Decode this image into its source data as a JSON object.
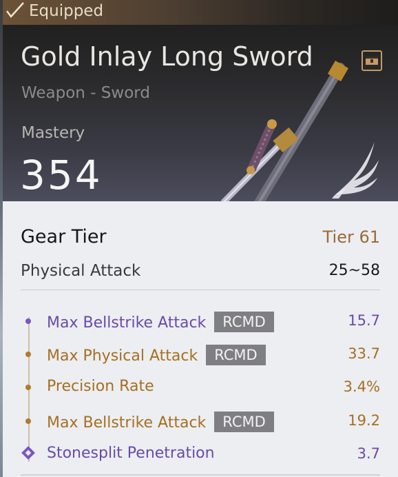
{
  "header": {
    "equipped_label": "Equipped",
    "item_name": "Gold Inlay Long Sword",
    "item_type": "Weapon - Sword",
    "mastery_label": "Mastery",
    "mastery_value": "354",
    "icons": [
      "check-icon",
      "chest-icon",
      "sword-image",
      "wing-icon"
    ]
  },
  "gear_tier": {
    "label": "Gear Tier",
    "value": "Tier 61"
  },
  "physical_attack": {
    "label": "Physical Attack",
    "value": "25~58"
  },
  "stats": [
    {
      "label": "Max Bellstrike Attack",
      "badge": "RCMD",
      "value": "15.7",
      "color": "#6a4aa8",
      "bullet": "purple-dot"
    },
    {
      "label": "Max Physical Attack",
      "badge": "RCMD",
      "value": "33.7",
      "color": "#a76f1f",
      "bullet": "gold-dot"
    },
    {
      "label": "Precision Rate",
      "badge": "",
      "value": "3.4%",
      "color": "#a76f1f",
      "bullet": "gold-dot"
    },
    {
      "label": "Max Bellstrike Attack",
      "badge": "RCMD",
      "value": "19.2",
      "color": "#a76f1f",
      "bullet": "gold-dot"
    },
    {
      "label": "Stonesplit Penetration",
      "badge": "",
      "value": "3.7",
      "color": "#6a4aa8",
      "bullet": "purple-diamond"
    }
  ],
  "colors": {
    "header_bg": "#2a2a2c",
    "panel_bg": "#eceef2",
    "tier_gold": "#9c6a38",
    "purple": "#6a4aa8",
    "gold": "#a76f1f",
    "badge_bg": "#7f7f83"
  }
}
